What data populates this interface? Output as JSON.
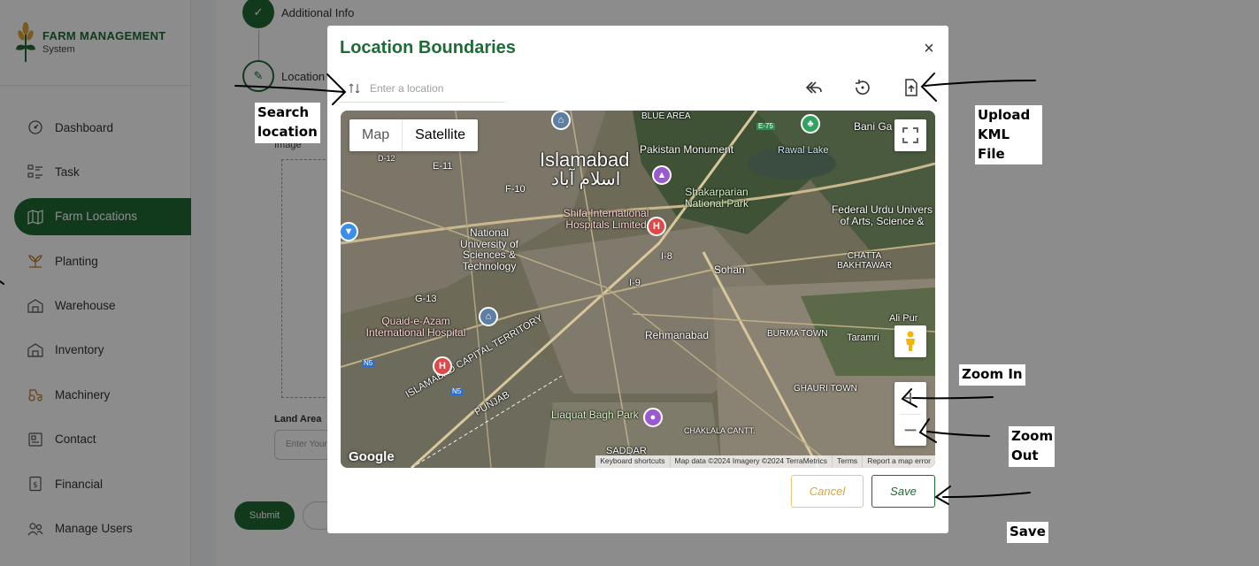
{
  "brand": {
    "title": "FARM MANAGEMENT",
    "subtitle": "System"
  },
  "sidebar": {
    "items": [
      {
        "label": "Dashboard",
        "icon": "dashboard-icon"
      },
      {
        "label": "Task",
        "icon": "task-icon"
      },
      {
        "label": "Farm Locations",
        "icon": "map-icon",
        "active": true
      },
      {
        "label": "Planting",
        "icon": "sprout-icon"
      },
      {
        "label": "Warehouse",
        "icon": "warehouse-icon"
      },
      {
        "label": "Inventory",
        "icon": "inventory-icon"
      },
      {
        "label": "Machinery",
        "icon": "machinery-icon"
      },
      {
        "label": "Contact",
        "icon": "contact-icon"
      },
      {
        "label": "Financial",
        "icon": "financial-icon"
      },
      {
        "label": "Manage Users",
        "icon": "users-icon"
      }
    ]
  },
  "steps": {
    "additional_info": "Additional Info",
    "location": "Location"
  },
  "form": {
    "image_label": "Image",
    "land_area_label": "Land Area",
    "land_area_placeholder": "Enter Your",
    "submit": "Submit"
  },
  "modal": {
    "title": "Location Boundaries",
    "close_symbol": "×",
    "search_placeholder": "Enter a location",
    "cancel_label": "Cancel",
    "save_label": "Save"
  },
  "map": {
    "type_map": "Map",
    "type_satellite": "Satellite",
    "labels": {
      "islamabad": "Islamabad",
      "islamabad_urdu": "اسلام آباد",
      "blue_area": "BLUE AREA",
      "pakistan_monument": "Pakistan Monument",
      "shakarparian": "Shakarparian National Park",
      "rawal_lake": "Rawal Lake",
      "bani_gala": "Bani Ga",
      "federal_urdu": "Federal Urdu Univers of Arts, Science &",
      "chatta": "CHATTA BAKHTAWAR",
      "shifa": "Shifa International Hospitals Limited",
      "nust": "National University of Sciences & Technology",
      "e11": "E-11",
      "f10": "F-10",
      "d12": "D-12",
      "i8": "I-8",
      "i9": "I-9",
      "g13": "G-13",
      "sohan": "Sohan",
      "quaid": "Quaid-e-Azam International Hospital",
      "rehmanabad": "Rehmanabad",
      "burma": "BURMA TOWN",
      "taramri": "Taramri",
      "alipur": "Ali Pur",
      "ict": "ISLAMABAD CAPITAL TERRITORY",
      "punjab": "PUNJAB",
      "liaquat": "Liaquat Bagh Park",
      "ghauri": "GHAURI TOWN",
      "chaklala": "CHAKLALA CANTT.",
      "saddar": "SADDAR",
      "n5": "N5",
      "e75": "E-75"
    },
    "google": "Google",
    "attribution": [
      "Keyboard shortcuts",
      "Map data ©2024 Imagery ©2024 TerraMetrics",
      "Terms",
      "Report a map error"
    ],
    "zoom_in": "+",
    "zoom_out": "−"
  },
  "annotations": {
    "search": "Search location",
    "upload": "Upload KML File",
    "zoom_in": "Zoom In",
    "zoom_out": "Zoom Out",
    "save": "Save"
  },
  "colors": {
    "brand_green": "#1f6b36",
    "cancel_gold": "#d9a441"
  }
}
